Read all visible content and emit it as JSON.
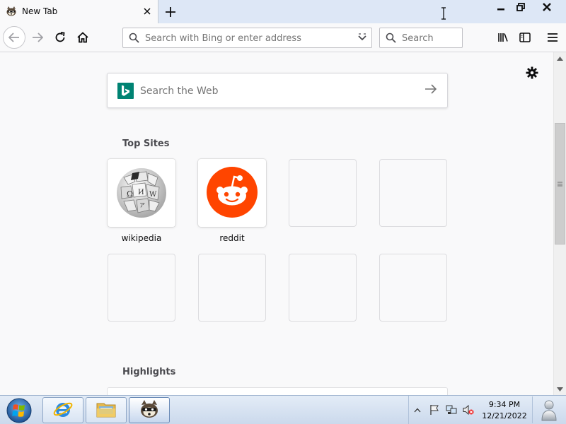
{
  "browser": {
    "tab": {
      "title": "New Tab",
      "favicon": "raccoon-icon"
    },
    "new_tab_icon": "plus-icon",
    "window_controls": [
      "minimize-icon",
      "restore-icon",
      "close-icon"
    ]
  },
  "toolbar": {
    "back_icon": "arrow-left-icon",
    "forward_icon": "arrow-right-icon",
    "reload_icon": "reload-icon",
    "home_icon": "home-icon",
    "url_placeholder": "Search with Bing or enter address",
    "search_placeholder": "Search",
    "library_icon": "library-icon",
    "sidebar_icon": "sidebar-icon",
    "menu_icon": "hamburger-menu-icon"
  },
  "newtab": {
    "settings_icon": "gear-icon",
    "web_search": {
      "placeholder": "Search the Web",
      "engine": "Bing",
      "engine_color": "#008373"
    },
    "top_sites": {
      "title": "Top Sites",
      "sites": [
        {
          "label": "wikipedia",
          "icon": "wikipedia-globe-icon"
        },
        {
          "label": "reddit",
          "icon": "reddit-icon",
          "color": "#ff4500"
        }
      ],
      "empty_slots": 6
    },
    "highlights": {
      "title": "Highlights"
    }
  },
  "taskbar": {
    "start_icon": "windows-start-icon",
    "pinned": [
      "internet-explorer-icon",
      "file-explorer-icon",
      "firefox-raccoon-icon"
    ],
    "tray_icons": [
      "show-hidden-icon",
      "action-center-flag-icon",
      "network-icon",
      "volume-muted-icon"
    ],
    "time": "9:34 PM",
    "date": "12/21/2022"
  }
}
